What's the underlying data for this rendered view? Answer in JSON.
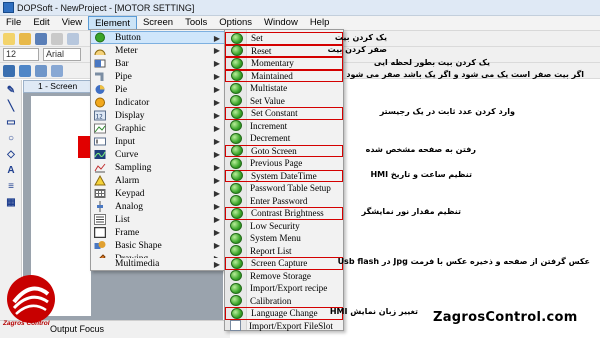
{
  "window": {
    "title": "DOPSoft - NewProject - [MOTOR SETTING]"
  },
  "menubar": {
    "items": [
      "File",
      "Edit",
      "View",
      "Element",
      "Screen",
      "Tools",
      "Options",
      "Window",
      "Help"
    ],
    "active": "Element"
  },
  "toolbar": {
    "font_size": "12",
    "font_name": "Arial"
  },
  "workspace": {
    "screen_tab": "1 - Screen"
  },
  "status": {
    "text": "Output Focus"
  },
  "element_menu": {
    "items": [
      {
        "label": "Button",
        "icon": "button-icon",
        "submenu": true,
        "selected": true
      },
      {
        "label": "Meter",
        "icon": "meter-icon",
        "submenu": true
      },
      {
        "label": "Bar",
        "icon": "bar-icon",
        "submenu": true
      },
      {
        "label": "Pipe",
        "icon": "pipe-icon",
        "submenu": true
      },
      {
        "label": "Pie",
        "icon": "pie-icon",
        "submenu": true
      },
      {
        "label": "Indicator",
        "icon": "indicator-icon",
        "submenu": true
      },
      {
        "label": "Display",
        "icon": "display-icon",
        "submenu": true
      },
      {
        "label": "Graphic",
        "icon": "graphic-icon",
        "submenu": true
      },
      {
        "label": "Input",
        "icon": "input-icon",
        "submenu": true
      },
      {
        "label": "Curve",
        "icon": "curve-icon",
        "submenu": true
      },
      {
        "label": "Sampling",
        "icon": "sampling-icon",
        "submenu": true
      },
      {
        "label": "Alarm",
        "icon": "alarm-icon",
        "submenu": true
      },
      {
        "label": "Keypad",
        "icon": "keypad-icon",
        "submenu": true
      },
      {
        "label": "Analog",
        "icon": "analog-icon",
        "submenu": true
      },
      {
        "label": "List",
        "icon": "list-icon",
        "submenu": true
      },
      {
        "label": "Frame",
        "icon": "frame-icon",
        "submenu": true
      },
      {
        "label": "Basic Shape",
        "icon": "basic-shape-icon",
        "submenu": true
      },
      {
        "label": "Drawing",
        "icon": "drawing-icon",
        "submenu": true
      },
      {
        "label": "Multimedia",
        "icon": "multimedia-icon",
        "submenu": true
      }
    ]
  },
  "button_submenu": {
    "items": [
      {
        "label": "Set",
        "boxed": true,
        "icon": "green-button-icon"
      },
      {
        "label": "Reset",
        "boxed": true,
        "icon": "green-button-icon"
      },
      {
        "label": "Momentary",
        "boxed": true,
        "icon": "green-button-icon"
      },
      {
        "label": "Maintained",
        "boxed": true,
        "icon": "green-button-icon"
      },
      {
        "label": "Multistate",
        "boxed": false,
        "icon": "green-button-icon"
      },
      {
        "label": "Set Value",
        "boxed": false,
        "icon": "green-button-icon"
      },
      {
        "label": "Set Constant",
        "boxed": true,
        "icon": "green-button-icon"
      },
      {
        "label": "Increment",
        "boxed": false,
        "icon": "green-button-icon"
      },
      {
        "label": "Decrement",
        "boxed": false,
        "icon": "green-button-icon"
      },
      {
        "label": "Goto Screen",
        "boxed": true,
        "icon": "green-button-icon"
      },
      {
        "label": "Previous Page",
        "boxed": false,
        "icon": "green-button-icon"
      },
      {
        "label": "System DateTime",
        "boxed": true,
        "icon": "green-button-icon"
      },
      {
        "label": "Password Table Setup",
        "boxed": false,
        "icon": "green-button-icon"
      },
      {
        "label": "Enter Password",
        "boxed": false,
        "icon": "green-button-icon"
      },
      {
        "label": "Contrast Brightness",
        "boxed": true,
        "icon": "green-button-icon"
      },
      {
        "label": "Low Security",
        "boxed": false,
        "icon": "green-button-icon"
      },
      {
        "label": "System Menu",
        "boxed": false,
        "icon": "green-button-icon"
      },
      {
        "label": "Report List",
        "boxed": false,
        "icon": "green-button-icon"
      },
      {
        "label": "Screen Capture",
        "boxed": true,
        "icon": "green-button-icon"
      },
      {
        "label": "Remove Storage",
        "boxed": false,
        "icon": "green-button-icon"
      },
      {
        "label": "Import/Export recipe",
        "boxed": false,
        "icon": "green-button-icon"
      },
      {
        "label": "Calibration",
        "boxed": false,
        "icon": "green-button-icon"
      },
      {
        "label": "Language Change",
        "boxed": true,
        "icon": "green-button-icon"
      },
      {
        "label": "Import/Export FileSlot",
        "boxed": false,
        "icon": "doc-icon"
      }
    ]
  },
  "annotations": [
    "یک کردن بیت",
    "صفر کردن بیت",
    "یک کردن بیت بطور لحظه ایی",
    "اگر بیت صفر است یک می شود و اگر یک باشد صفر می شود",
    "وارد کردن عدد ثابت در یک رجیستر",
    "رفتن به صفحه مشخص شده",
    "تنظیم ساعت و تاریخ HMI",
    "تنظیم مقدار نور نمایشگر",
    "عکس گرفتن از صفحه و ذخیره عکس با فرمت Jpg در Usb flash",
    "تغییر زبان نمایش HMI"
  ],
  "watermark": "ZagrosControl.com",
  "logo": {
    "text": "Zagros Control"
  },
  "colors": {
    "highlight_box": "#d40000",
    "menu_bg": "#f2f2f2",
    "selected_row": "#cfe6fb",
    "logo_red": "#c80000"
  }
}
